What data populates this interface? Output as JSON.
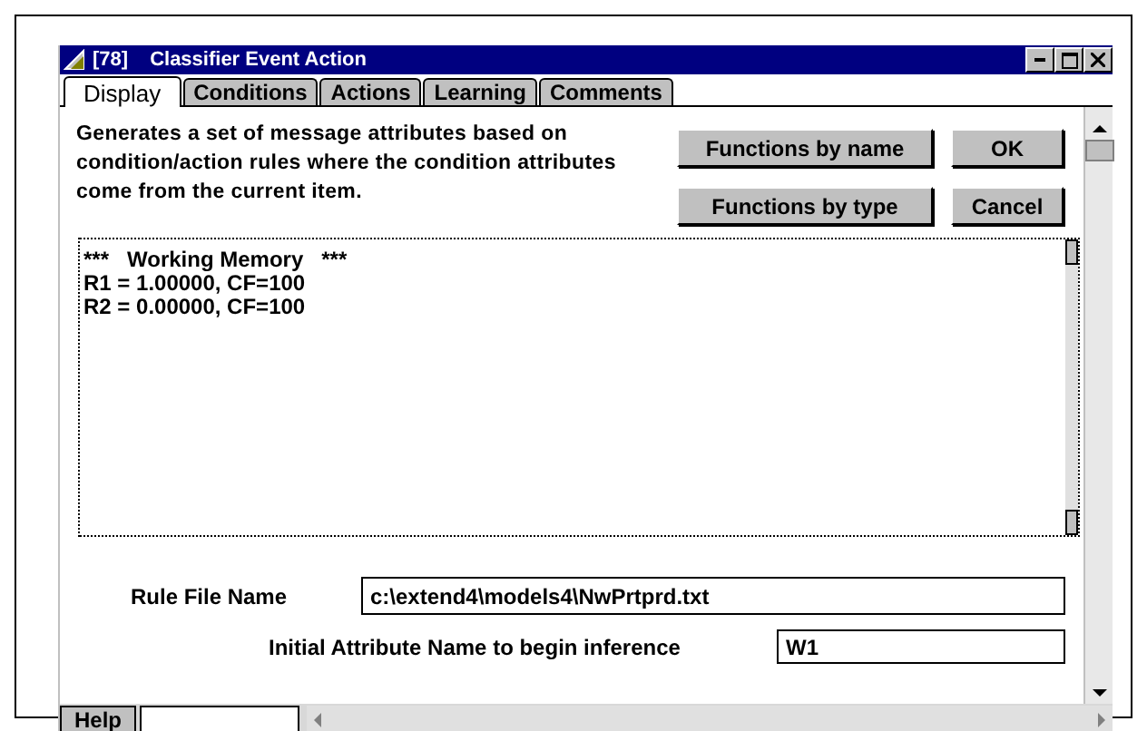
{
  "window": {
    "id": "[78]",
    "title": "Classifier Event Action"
  },
  "tabs": [
    {
      "label": "Display",
      "selected": true
    },
    {
      "label": "Conditions",
      "selected": false
    },
    {
      "label": "Actions",
      "selected": false
    },
    {
      "label": "Learning",
      "selected": false
    },
    {
      "label": "Comments",
      "selected": false
    }
  ],
  "description": "Generates a set of message attributes based on condition/action rules where the condition attributes come from the current item.",
  "buttons": [
    {
      "label": "Functions by name"
    },
    {
      "label": "OK"
    },
    {
      "label": "Functions by type"
    },
    {
      "label": "Cancel"
    }
  ],
  "output_lines": [
    "***   Working Memory   ***",
    "R1 = 1.00000, CF=100",
    "R2 = 0.00000, CF=100"
  ],
  "fields": [
    {
      "label": "Rule File Name",
      "value": "c:\\extend4\\models4\\NwPrtprd.txt"
    },
    {
      "label": "Initial Attribute Name to begin inference",
      "value": "W1"
    }
  ],
  "status_bar": {
    "help": "Help"
  }
}
